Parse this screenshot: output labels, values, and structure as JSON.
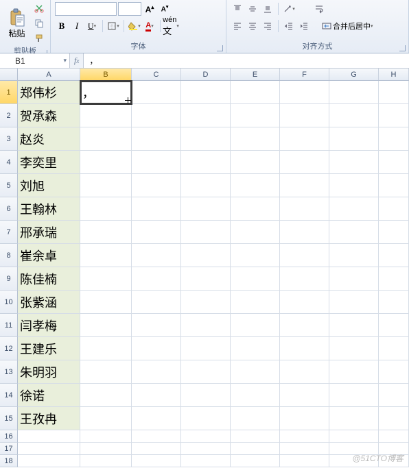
{
  "ribbon": {
    "clipboard": {
      "paste": "粘贴",
      "label": "剪贴板"
    },
    "font": {
      "family": "",
      "size": "",
      "bold": "B",
      "italic": "I",
      "underline": "U",
      "label": "字体"
    },
    "alignment": {
      "merge": "合并后居中",
      "label": "对齐方式"
    }
  },
  "namebox": "B1",
  "formula": "，",
  "columns": [
    "A",
    "B",
    "C",
    "D",
    "E",
    "F",
    "G",
    "H"
  ],
  "selectedCol": "B",
  "selectedRow": 1,
  "activeCell": {
    "row": 1,
    "col": "B",
    "value": "，"
  },
  "dataRows": 15,
  "emptyRows": [
    16,
    17,
    18
  ],
  "names": [
    "郑伟杉",
    "贺承森",
    "赵炎",
    "李奕里",
    "刘旭",
    "王翰林",
    "邢承瑞",
    "崔余卓",
    "陈佳楠",
    "张紫涵",
    "闫孝梅",
    "王建乐",
    "朱明羽",
    "徐诺",
    "王孜冉"
  ],
  "watermark": "@51CTO博客"
}
